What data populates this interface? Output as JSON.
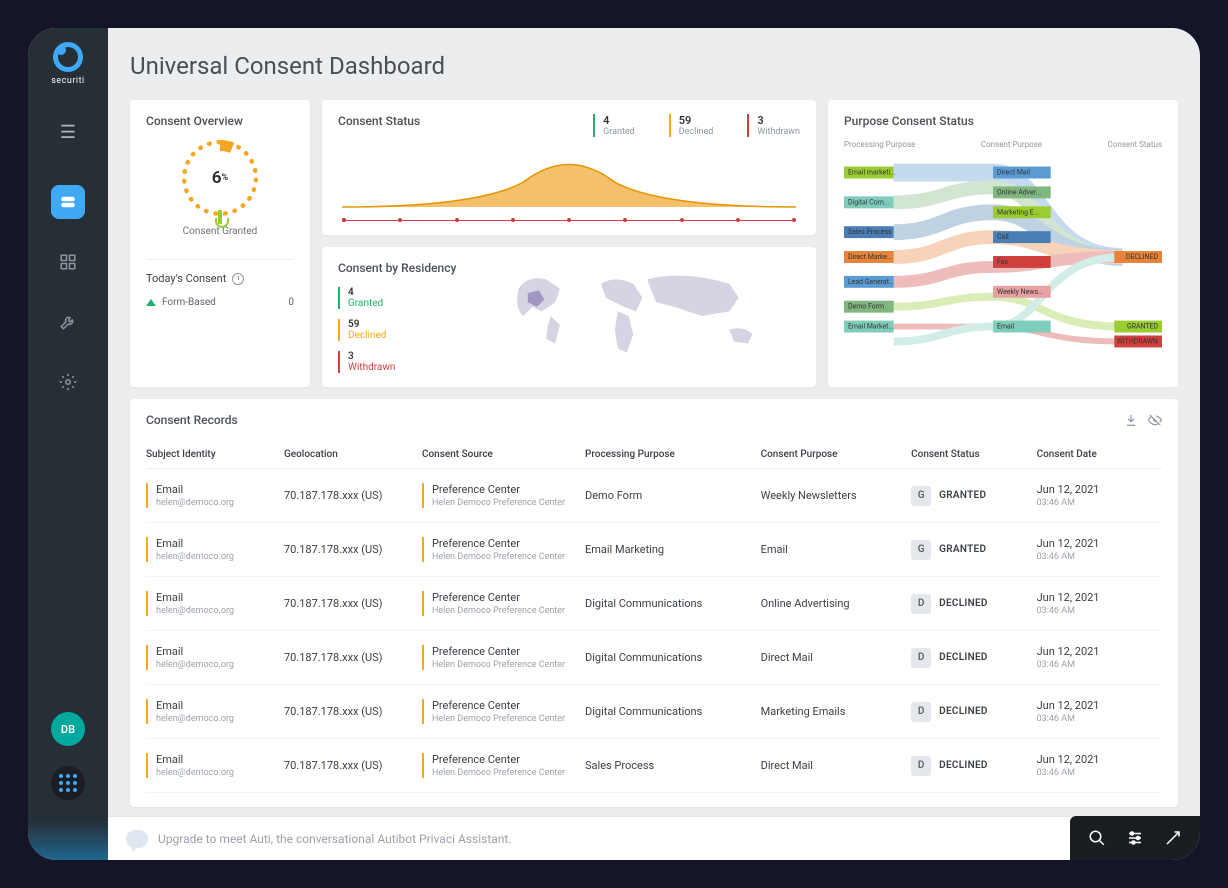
{
  "brand": "securiti",
  "page_title": "Universal Consent Dashboard",
  "avatar_initials": "DB",
  "overview": {
    "title": "Consent Overview",
    "percent": "6",
    "percent_suffix": "%",
    "label": "Consent Granted",
    "today_title": "Today's Consent",
    "form_label": "Form-Based",
    "form_value": "0"
  },
  "status": {
    "title": "Consent Status",
    "granted": {
      "value": "4",
      "label": "Granted"
    },
    "declined": {
      "value": "59",
      "label": "Declined"
    },
    "withdrawn": {
      "value": "3",
      "label": "Withdrawn"
    }
  },
  "residency": {
    "title": "Consent by Residency",
    "granted": {
      "value": "4",
      "label": "Granted"
    },
    "declined": {
      "value": "59",
      "label": "Declined"
    },
    "withdrawn": {
      "value": "3",
      "label": "Withdrawn"
    }
  },
  "sankey": {
    "title": "Purpose Consent Status",
    "col1": "Processing Purpose",
    "col2": "Consent Purpose",
    "col3": "Consent Status",
    "left_nodes": [
      "Email marketi...",
      "Digital Com...",
      "Sales Process",
      "Direct Marke...",
      "Lead Generat...",
      "Demo Form",
      "Email Market..."
    ],
    "mid_nodes": [
      "Direct Mail",
      "Online Adver...",
      "Marketing E...",
      "Call",
      "Fax",
      "Weekly News...",
      "Email"
    ],
    "right_nodes": [
      "DECLINED",
      "GRANTED",
      "WITHDRAWN"
    ]
  },
  "records": {
    "title": "Consent Records",
    "headers": [
      "Subject Identity",
      "Geolocation",
      "Consent Source",
      "Processing Purpose",
      "Consent Purpose",
      "Consent Status",
      "Consent Date"
    ],
    "rows": [
      {
        "identity": "Email",
        "identity_sub": "helen@democo.org",
        "geo": "70.187.178.xxx (US)",
        "source": "Preference Center",
        "source_sub": "Helen Democo Preference Center",
        "purpose": "Demo Form",
        "consent_purpose": "Weekly Newsletters",
        "status_code": "G",
        "status": "GRANTED",
        "date": "Jun 12, 2021",
        "time": "03:46 AM"
      },
      {
        "identity": "Email",
        "identity_sub": "helen@democo.org",
        "geo": "70.187.178.xxx (US)",
        "source": "Preference Center",
        "source_sub": "Helen Democo Preference Center",
        "purpose": "Email Marketing",
        "consent_purpose": "Email",
        "status_code": "G",
        "status": "GRANTED",
        "date": "Jun 12, 2021",
        "time": "03:46 AM"
      },
      {
        "identity": "Email",
        "identity_sub": "helen@democo.org",
        "geo": "70.187.178.xxx (US)",
        "source": "Preference Center",
        "source_sub": "Helen Democo Preference Center",
        "purpose": "Digital Communications",
        "consent_purpose": "Online Advertising",
        "status_code": "D",
        "status": "DECLINED",
        "date": "Jun 12, 2021",
        "time": "03:46 AM"
      },
      {
        "identity": "Email",
        "identity_sub": "helen@democo.org",
        "geo": "70.187.178.xxx (US)",
        "source": "Preference Center",
        "source_sub": "Helen Democo Preference Center",
        "purpose": "Digital Communications",
        "consent_purpose": "Direct Mail",
        "status_code": "D",
        "status": "DECLINED",
        "date": "Jun 12, 2021",
        "time": "03:46 AM"
      },
      {
        "identity": "Email",
        "identity_sub": "helen@democo.org",
        "geo": "70.187.178.xxx (US)",
        "source": "Preference Center",
        "source_sub": "Helen Democo Preference Center",
        "purpose": "Digital Communications",
        "consent_purpose": "Marketing Emails",
        "status_code": "D",
        "status": "DECLINED",
        "date": "Jun 12, 2021",
        "time": "03:46 AM"
      },
      {
        "identity": "Email",
        "identity_sub": "helen@democo.org",
        "geo": "70.187.178.xxx (US)",
        "source": "Preference Center",
        "source_sub": "Helen Democo Preference Center",
        "purpose": "Sales Process",
        "consent_purpose": "Direct Mail",
        "status_code": "D",
        "status": "DECLINED",
        "date": "Jun 12, 2021",
        "time": "03:46 AM"
      }
    ]
  },
  "footer_text": "Upgrade to meet Auti, the conversational Autibot Privaci Assistant.",
  "colors": {
    "primary": "#3fa9f5",
    "orange": "#f5a623",
    "green": "#1db56c",
    "red": "#d0413e"
  }
}
